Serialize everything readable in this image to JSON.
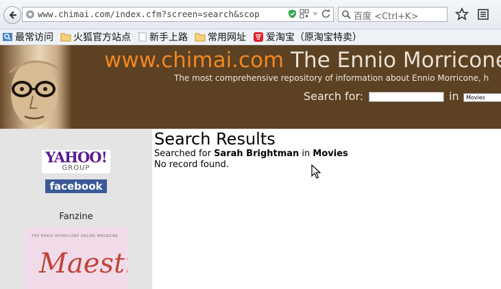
{
  "browser": {
    "url": "www.chimai.com/index.cfm?screen=search&scop",
    "search_placeholder": "百度 <Ctrl+K>",
    "bookmarks": [
      {
        "label": "最常访问",
        "icon": "most-visited-icon"
      },
      {
        "label": "火狐官方站点",
        "icon": "folder-icon"
      },
      {
        "label": "新手上路",
        "icon": "page-icon"
      },
      {
        "label": "常用网址",
        "icon": "folder-icon"
      },
      {
        "label": "爱淘宝（原淘宝特卖）",
        "icon": "taobao-icon"
      }
    ]
  },
  "header": {
    "title_domain": "www.chimai.com",
    "title_rest": " The Ennio Morricone",
    "tagline": "The most comprehensive repository of information about Ennio Morricone, h",
    "search_label": "Search for:",
    "search_value": "",
    "in_label": "in",
    "category_selected": "Movies"
  },
  "sidebar": {
    "yahoo_text": "YAHOO!",
    "yahoo_group": "GROUP",
    "facebook_text": "facebook",
    "fanzine_label": "Fanzine",
    "magazine_top": "THE ENNIO MORRICONE ONLINE MAGAZINE",
    "magazine_title": "Maestro"
  },
  "main": {
    "title": "Search Results",
    "searched_prefix": "Searched for ",
    "query": "Sarah Brightman",
    "in_word": " in ",
    "category": "Movies",
    "message": "No record found."
  },
  "colors": {
    "header_bg": "#5c4123",
    "domain_orange": "#f2871f",
    "sidebar_bg": "#e4e4e4",
    "facebook_blue": "#3b5998",
    "yahoo_purple": "#5a1a8e"
  }
}
